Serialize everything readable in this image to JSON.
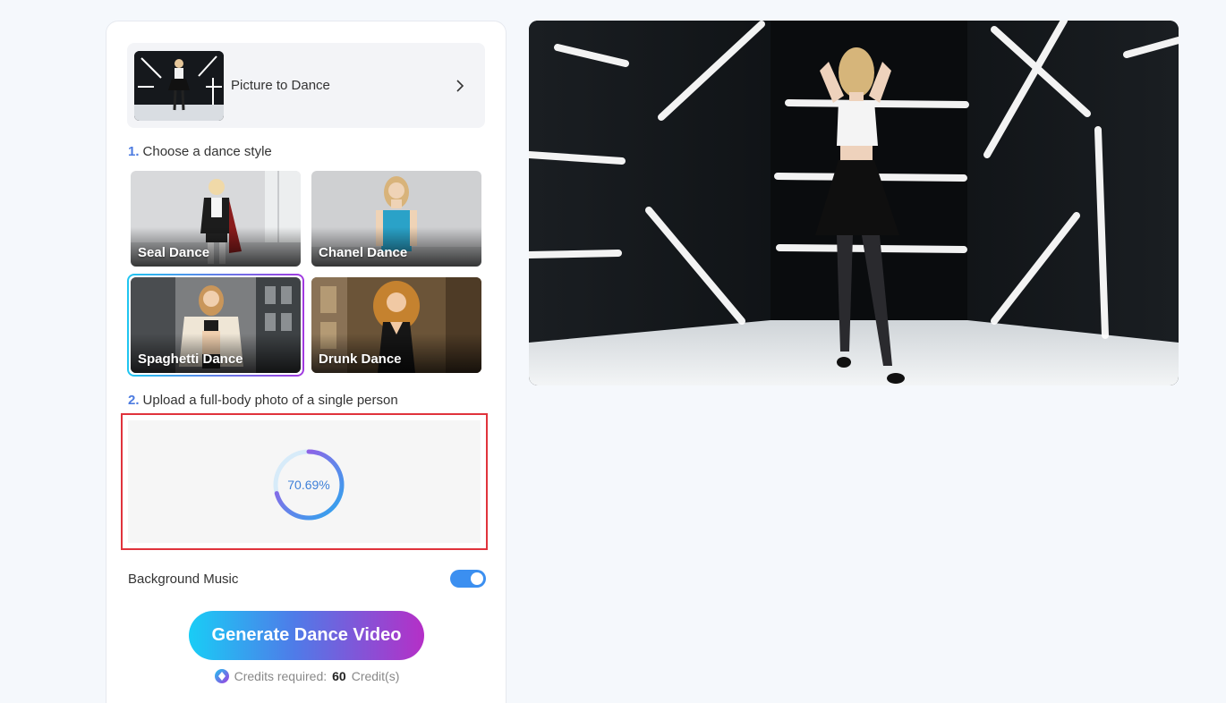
{
  "tool": {
    "label": "Picture to Dance"
  },
  "step1": {
    "num": "1.",
    "title": "Choose a dance style"
  },
  "styles": [
    {
      "name": "Seal Dance",
      "selected": false
    },
    {
      "name": "Chanel Dance",
      "selected": false
    },
    {
      "name": "Spaghetti Dance",
      "selected": true
    },
    {
      "name": "Drunk Dance",
      "selected": false
    }
  ],
  "step2": {
    "num": "2.",
    "title": "Upload a full-body photo of a single person"
  },
  "upload": {
    "progress_text": "70.69%",
    "progress_fraction": 0.7069
  },
  "music": {
    "label": "Background Music",
    "enabled": true
  },
  "generate": {
    "label": "Generate Dance Video"
  },
  "credits": {
    "prefix": "Credits required:",
    "amount": "60",
    "suffix": "Credit(s)"
  },
  "colors": {
    "accent_blue": "#3b8ff0",
    "highlight_red": "#e0333c",
    "gradient_start": "#19cdf6",
    "gradient_end": "#b52fc7"
  }
}
